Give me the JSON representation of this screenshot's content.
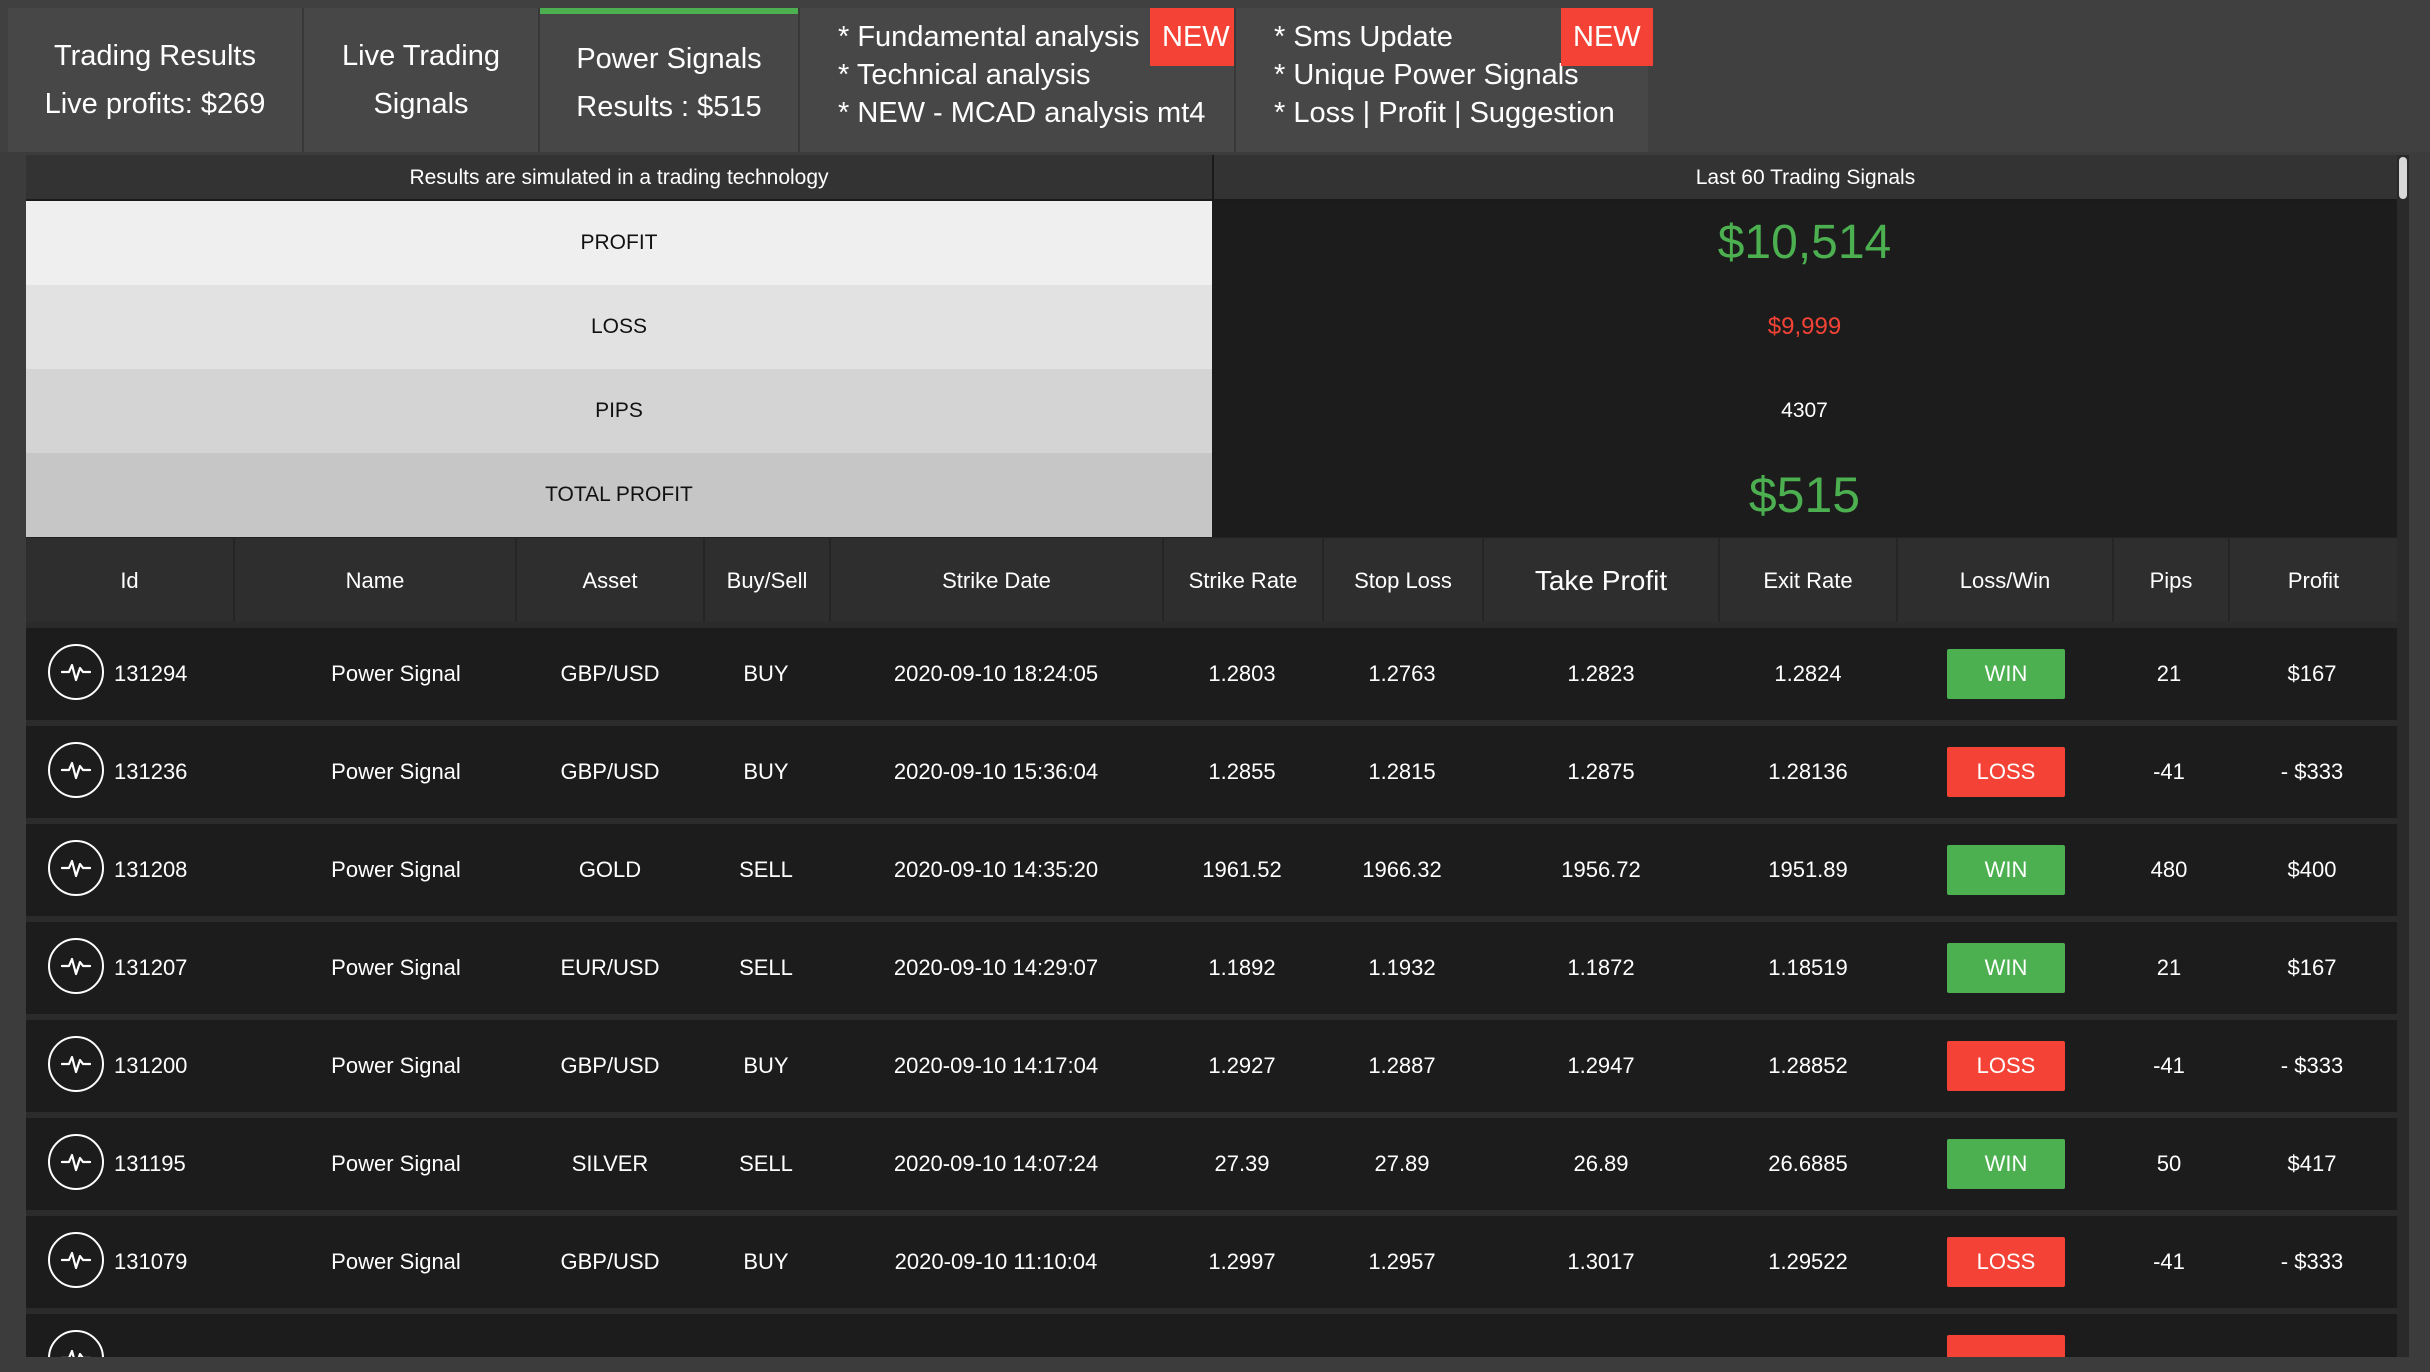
{
  "tabs": [
    {
      "line1": "Trading Results",
      "line2": "Live profits: $269"
    },
    {
      "line1": "Live Trading",
      "line2": "Signals"
    },
    {
      "line1": "Power Signals",
      "line2": "Results : $515"
    }
  ],
  "promos": [
    {
      "badge": "NEW",
      "lines": [
        "* Fundamental analysis",
        "* Technical analysis",
        "* NEW - MCAD analysis mt4"
      ]
    },
    {
      "badge": "NEW",
      "lines": [
        "* Sms Update",
        "* Unique Power Signals",
        "* Loss | Profit | Suggestion"
      ]
    }
  ],
  "summary": {
    "left_header": "Results are simulated in a trading technology",
    "right_header": "Last 60 Trading Signals",
    "profit_label": "PROFIT",
    "profit_value": "$10,514",
    "loss_label": "LOSS",
    "loss_value": "$9,999",
    "pips_label": "PIPS",
    "pips_value": "4307",
    "total_label": "TOTAL PROFIT",
    "total_value": "$515"
  },
  "table": {
    "columns": [
      "Id",
      "Name",
      "Asset",
      "Buy/Sell",
      "Strike Date",
      "Strike Rate",
      "Stop Loss",
      "Take Profit",
      "Exit Rate",
      "Loss/Win",
      "Pips",
      "Profit"
    ],
    "rows": [
      {
        "id": "131294",
        "name": "Power Signal",
        "asset": "GBP/USD",
        "side": "BUY",
        "date": "2020-09-10 18:24:05",
        "strike": "1.2803",
        "stop": "1.2763",
        "take": "1.2823",
        "exit": "1.2824",
        "result": "WIN",
        "pips": "21",
        "profit": "$167"
      },
      {
        "id": "131236",
        "name": "Power Signal",
        "asset": "GBP/USD",
        "side": "BUY",
        "date": "2020-09-10 15:36:04",
        "strike": "1.2855",
        "stop": "1.2815",
        "take": "1.2875",
        "exit": "1.28136",
        "result": "LOSS",
        "pips": "-41",
        "profit": "- $333"
      },
      {
        "id": "131208",
        "name": "Power Signal",
        "asset": "GOLD",
        "side": "SELL",
        "date": "2020-09-10 14:35:20",
        "strike": "1961.52",
        "stop": "1966.32",
        "take": "1956.72",
        "exit": "1951.89",
        "result": "WIN",
        "pips": "480",
        "profit": "$400"
      },
      {
        "id": "131207",
        "name": "Power Signal",
        "asset": "EUR/USD",
        "side": "SELL",
        "date": "2020-09-10 14:29:07",
        "strike": "1.1892",
        "stop": "1.1932",
        "take": "1.1872",
        "exit": "1.18519",
        "result": "WIN",
        "pips": "21",
        "profit": "$167"
      },
      {
        "id": "131200",
        "name": "Power Signal",
        "asset": "GBP/USD",
        "side": "BUY",
        "date": "2020-09-10 14:17:04",
        "strike": "1.2927",
        "stop": "1.2887",
        "take": "1.2947",
        "exit": "1.28852",
        "result": "LOSS",
        "pips": "-41",
        "profit": "- $333"
      },
      {
        "id": "131195",
        "name": "Power Signal",
        "asset": "SILVER",
        "side": "SELL",
        "date": "2020-09-10 14:07:24",
        "strike": "27.39",
        "stop": "27.89",
        "take": "26.89",
        "exit": "26.6885",
        "result": "WIN",
        "pips": "50",
        "profit": "$417"
      },
      {
        "id": "131079",
        "name": "Power Signal",
        "asset": "GBP/USD",
        "side": "BUY",
        "date": "2020-09-10 11:10:04",
        "strike": "1.2997",
        "stop": "1.2957",
        "take": "1.3017",
        "exit": "1.29522",
        "result": "LOSS",
        "pips": "-41",
        "profit": "- $333"
      }
    ]
  },
  "colors": {
    "win": "#4caf50",
    "loss": "#f44336",
    "accent": "#4caf50"
  },
  "icons": {
    "row": "pulse-icon"
  }
}
